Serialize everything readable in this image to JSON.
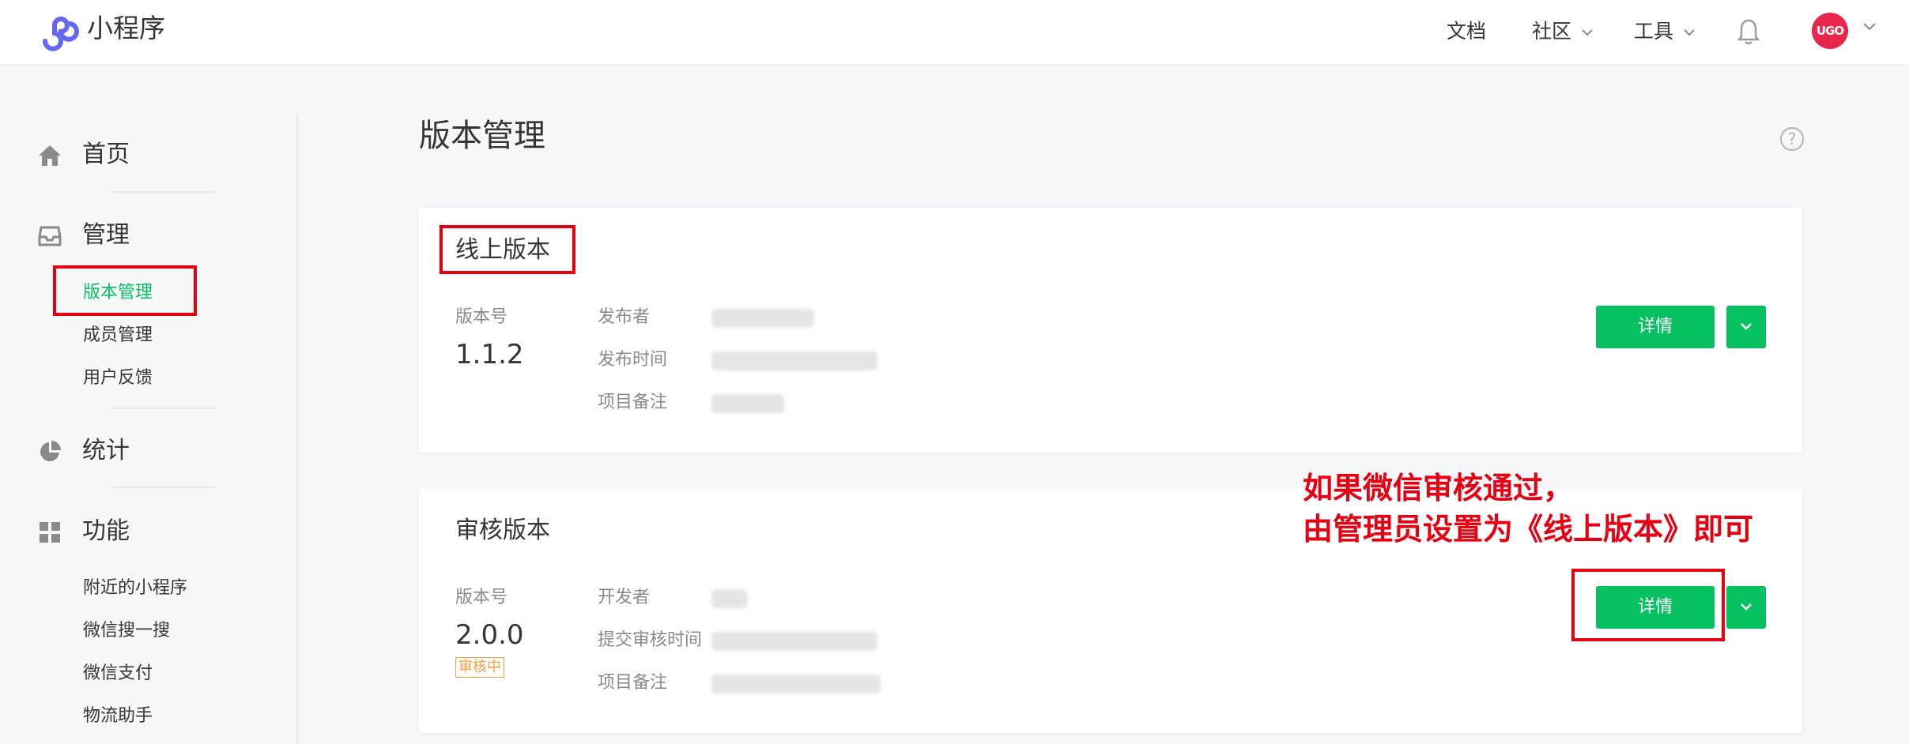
{
  "header": {
    "brand": "小程序",
    "nav": [
      {
        "label": "文档",
        "has_dropdown": false
      },
      {
        "label": "社区",
        "has_dropdown": true
      },
      {
        "label": "工具",
        "has_dropdown": true
      }
    ],
    "avatar_text": "UGO",
    "notification_icon": "bell-icon",
    "brand_color": "#07c160"
  },
  "sidebar": {
    "groups": [
      {
        "label": "首页",
        "icon": "home-icon"
      },
      {
        "label": "管理",
        "icon": "inbox-icon"
      },
      {
        "label": "统计",
        "icon": "pie-chart-icon"
      },
      {
        "label": "功能",
        "icon": "grid-icon"
      }
    ],
    "manage_items": [
      "版本管理",
      "成员管理",
      "用户反馈"
    ],
    "feature_items": [
      "附近的小程序",
      "微信搜一搜",
      "微信支付",
      "物流助手"
    ],
    "active_item": "版本管理"
  },
  "main": {
    "title": "版本管理",
    "help_icon": "question-icon",
    "help_glyph": "?",
    "online": {
      "title": "线上版本",
      "version_label": "版本号",
      "version": "1.1.2",
      "fields": [
        "发布者",
        "发布时间",
        "项目备注"
      ],
      "detail_button": "详情"
    },
    "review": {
      "title": "审核版本",
      "version_label": "版本号",
      "version": "2.0.0",
      "status": "审核中",
      "fields": [
        "开发者",
        "提交审核时间",
        "项目备注"
      ],
      "detail_button": "详情"
    }
  },
  "annotation": {
    "line1": "如果微信审核通过，",
    "line2": "由管理员设置为《线上版本》即可",
    "color": "#e60012"
  }
}
